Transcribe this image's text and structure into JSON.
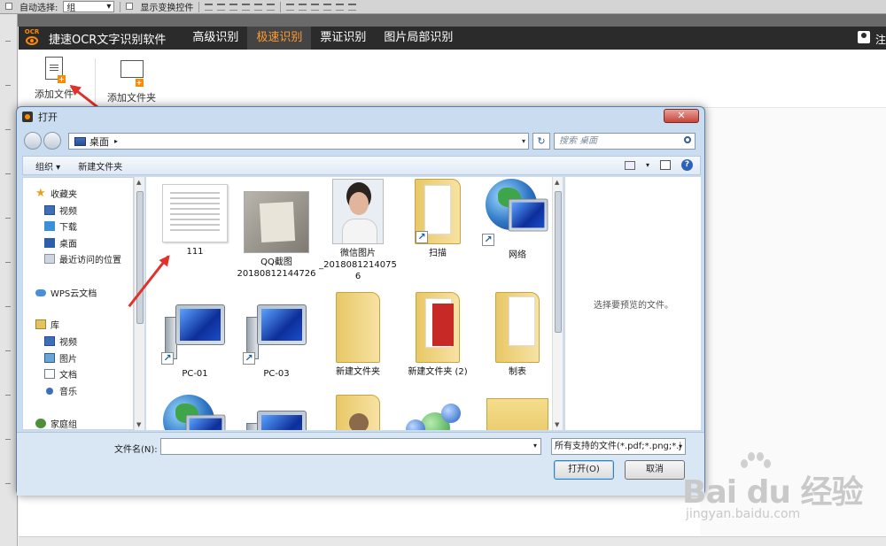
{
  "ps_toolbar": {
    "auto_select_label": "自动选择:",
    "auto_select_value": "组",
    "show_transform_label": "显示变换控件"
  },
  "app": {
    "logo_text": "OCR",
    "title": "捷速OCR文字识别软件",
    "tabs": [
      {
        "label": "高级识别",
        "active": false
      },
      {
        "label": "极速识别",
        "active": true
      },
      {
        "label": "票证识别",
        "active": false
      },
      {
        "label": "图片局部识别",
        "active": false
      }
    ],
    "user_label": "注",
    "toolbar": {
      "add_file": "添加文件",
      "add_folder": "添加文件夹"
    },
    "accent_color": "#ff8a00"
  },
  "dialog": {
    "title": "打开",
    "address": "桌面",
    "search_placeholder": "搜索 桌面",
    "organize": "组织 ▾",
    "new_folder": "新建文件夹",
    "nav": [
      {
        "label": "收藏夹",
        "icon": "star-icon"
      },
      {
        "label": "视频",
        "icon": "video-icon"
      },
      {
        "label": "下载",
        "icon": "download-icon"
      },
      {
        "label": "桌面",
        "icon": "desktop-icon"
      },
      {
        "label": "最近访问的位置",
        "icon": "recent-icon"
      },
      {
        "label": "WPS云文档",
        "icon": "cloud-icon"
      },
      {
        "label": "库",
        "icon": "library-icon"
      },
      {
        "label": "视频",
        "icon": "video-icon"
      },
      {
        "label": "图片",
        "icon": "picture-icon"
      },
      {
        "label": "文档",
        "icon": "document-icon"
      },
      {
        "label": "音乐",
        "icon": "music-icon"
      },
      {
        "label": "家庭组",
        "icon": "homegroup-icon"
      }
    ],
    "files": [
      {
        "name": "111",
        "kind": "doc"
      },
      {
        "name": "QQ截图\n20180812144726",
        "kind": "photo"
      },
      {
        "name": "微信图片\n_20180812140756",
        "kind": "person"
      },
      {
        "name": "扫描",
        "kind": "folder-shortcut"
      },
      {
        "name": "网络",
        "kind": "globe-shortcut"
      },
      {
        "name": "PC-01",
        "kind": "pc"
      },
      {
        "name": "PC-03",
        "kind": "pc"
      },
      {
        "name": "新建文件夹",
        "kind": "folder"
      },
      {
        "name": "新建文件夹 (2)",
        "kind": "folder-red"
      },
      {
        "name": "制表",
        "kind": "folder"
      },
      {
        "name": "",
        "kind": "globe"
      },
      {
        "name": "",
        "kind": "pc"
      },
      {
        "name": "",
        "kind": "user-folder"
      },
      {
        "name": "",
        "kind": "balls"
      },
      {
        "name": "",
        "kind": "folder-open"
      }
    ],
    "preview_text": "选择要预览的文件。",
    "filename_label": "文件名(N):",
    "filename_value": "",
    "filetype_value": "所有支持的文件(*.pdf;*.png;*.j",
    "open_button": "打开(O)",
    "cancel_button": "取消"
  },
  "watermark": {
    "main": "Bai du 经验",
    "sub": "jingyan.baidu.com"
  }
}
